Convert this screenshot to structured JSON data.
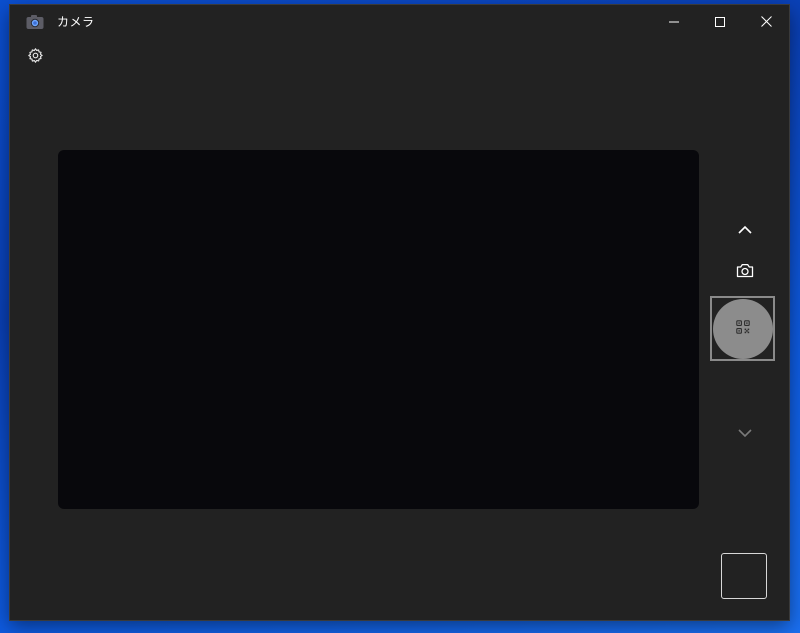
{
  "window": {
    "title": "カメラ",
    "minimize_icon": "minimize-icon",
    "maximize_icon": "maximize-icon",
    "close_icon": "close-icon"
  },
  "toolbar": {
    "settings_icon": "gear-icon"
  },
  "side_controls": {
    "mode_up_icon": "chevron-up-icon",
    "photo_mode_icon": "camera-icon",
    "capture_icon": "qr-code-icon",
    "mode_down_icon": "chevron-down-icon"
  },
  "colors": {
    "window_bg": "#222222",
    "viewfinder_bg": "#08080c",
    "capture_button": "#8c8c8c",
    "desktop_accent": "#0b4fd0"
  }
}
